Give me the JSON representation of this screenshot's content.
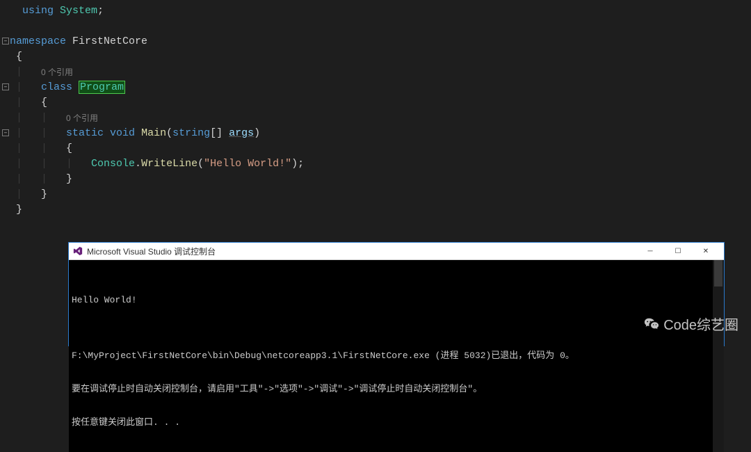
{
  "code": {
    "tokens": {
      "using": "using",
      "system": "System",
      "namespace": "namespace",
      "ns_name": "FirstNetCore",
      "class_kw": "class",
      "class_name": "Program",
      "static": "static",
      "void": "void",
      "main": "Main",
      "string": "string",
      "args": "args",
      "console": "Console",
      "writeline": "WriteLine",
      "hello_str": "\"Hello World!\"",
      "semi": ";",
      "dot": ".",
      "open_b": "{",
      "close_b": "}",
      "open_p": "(",
      "close_p": ")",
      "brackets": "[]"
    },
    "codelens": {
      "refs_0": "0 个引用"
    }
  },
  "console": {
    "title": "Microsoft Visual Studio 调试控制台",
    "lines": {
      "l1": "Hello World!",
      "l2": "",
      "l3": "F:\\MyProject\\FirstNetCore\\bin\\Debug\\netcoreapp3.1\\FirstNetCore.exe (进程 5032)已退出，代码为 0。",
      "l4": "要在调试停止时自动关闭控制台，请启用\"工具\"->\"选项\"->\"调试\"->\"调试停止时自动关闭控制台\"。",
      "l5": "按任意键关闭此窗口. . ."
    },
    "buttons": {
      "minimize": "─",
      "maximize": "☐",
      "close": "✕"
    }
  },
  "watermark": {
    "text": "Code综艺圈"
  }
}
